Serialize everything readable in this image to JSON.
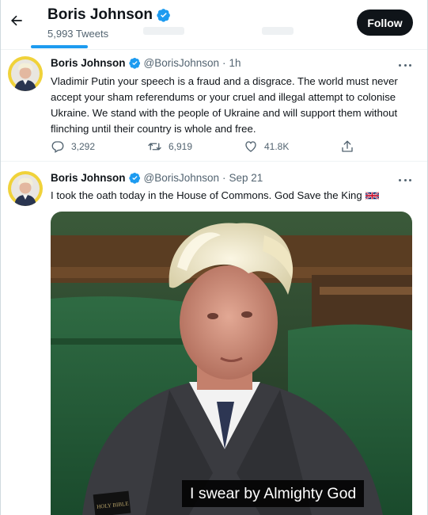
{
  "header": {
    "name": "Boris Johnson",
    "tweet_count": "5,993 Tweets",
    "follow_label": "Follow"
  },
  "tweets": [
    {
      "name": "Boris Johnson",
      "handle": "@BorisJohnson",
      "separator": "·",
      "time": "1h",
      "text": "Vladimir Putin your speech is a fraud and a disgrace. The world must never accept your sham referendums or your cruel and illegal attempt to colonise Ukraine. We stand with the people of Ukraine and will support them without flinching until their country is whole and free.",
      "replies": "3,292",
      "retweets": "6,919",
      "likes": "41.8K"
    },
    {
      "name": "Boris Johnson",
      "handle": "@BorisJohnson",
      "separator": "·",
      "time": "Sep 21",
      "text": "I took the oath today in the House of Commons. God Save the King",
      "video_caption": "I swear by Almighty God",
      "book_text": "HOLY BIBLE"
    }
  ],
  "icons": {
    "back": "arrow-left-icon",
    "verified": "verified-badge-icon",
    "more": "more-dots-icon",
    "reply": "reply-icon",
    "retweet": "retweet-icon",
    "like": "heart-icon",
    "share": "share-icon",
    "flag": "uk-flag-emoji"
  },
  "colors": {
    "accent": "#1d9bf0",
    "text_primary": "#0f1419",
    "text_secondary": "#536471",
    "follow_bg": "#0f1419"
  }
}
